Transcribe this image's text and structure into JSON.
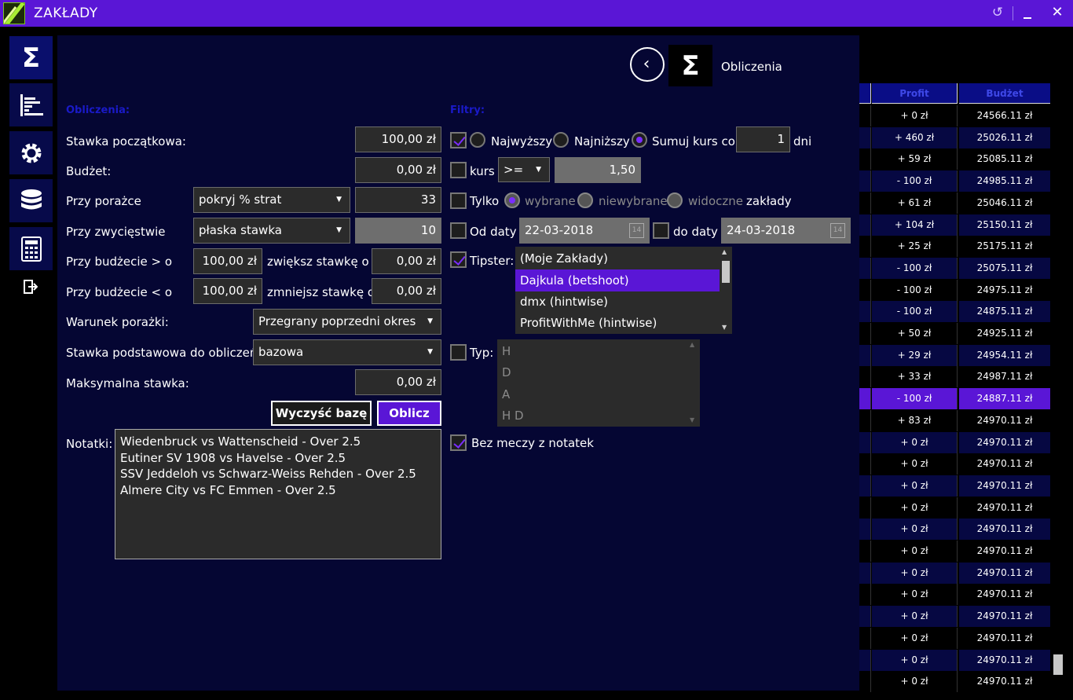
{
  "window": {
    "title": "ZAKŁADY"
  },
  "nav": {
    "sum_symbol": "Σ"
  },
  "header": {
    "title": "Obliczenia",
    "sum_symbol": "Σ",
    "back_glyph": "‹"
  },
  "calc": {
    "section_title": "Obliczenia:",
    "starting_stake_label": "Stawka początkowa:",
    "starting_stake_value": "100,00 zł",
    "budget_label": "Budżet:",
    "budget_value": "0,00 zł",
    "on_loss_label": "Przy porażce",
    "on_loss_mode": "pokryj % strat",
    "on_loss_value": "33",
    "on_win_label": "Przy zwycięstwie",
    "on_win_mode": "płaska stawka",
    "on_win_value": "10",
    "budget_gt_label": "Przy budżecie > o",
    "budget_gt_value": "100,00 zł",
    "increase_label": "zwiększ stawkę o",
    "increase_value": "0,00 zł",
    "budget_lt_label": "Przy budżecie < o",
    "budget_lt_value": "100,00 zł",
    "decrease_label": "zmniejsz stawkę o",
    "decrease_value": "0,00 zł",
    "loss_condition_label": "Warunek porażki:",
    "loss_condition_value": "Przegrany poprzedni okres",
    "base_stake_label": "Stawka podstawowa do obliczeń:",
    "base_stake_value": "bazowa",
    "max_stake_label": "Maksymalna stawka:",
    "max_stake_value": "0,00 zł",
    "clear_button": "Wyczyść bazę",
    "calc_button": "Oblicz",
    "notes_label": "Notatki:",
    "notes": [
      "Wiedenbruck vs Wattenscheid - Over 2.5",
      "Eutiner SV 1908 vs Havelse - Over 2.5",
      "SSV Jeddeloh vs Schwarz-Weiss Rehden - Over 2.5",
      "Almere City vs FC Emmen - Over 2.5"
    ]
  },
  "filters": {
    "section_title": "Filtry:",
    "radio_highest": "Najwyższy",
    "radio_lowest": "Najniższy",
    "radio_sum": "Sumuj",
    "odds_every_label": "kurs co",
    "odds_every_value": "1",
    "days_label": "dni",
    "odds_label": "kurs",
    "odds_operator": ">=",
    "odds_value": "1,50",
    "only_label": "Tylko",
    "radio_selected": "wybrane",
    "radio_unselected": "niewybrane",
    "radio_visible": "widoczne",
    "bets_label": "zakłady",
    "from_date_label": "Od daty",
    "from_date": "22-03-2018",
    "to_date_label": "do daty",
    "to_date": "24-03-2018",
    "calendar_day": "14",
    "tipster_label": "Tipster:",
    "tipsters": [
      "(Moje Zakłady)",
      "Dajkula (betshoot)",
      "dmx (hintwise)",
      "ProfitWithMe (hintwise)"
    ],
    "type_label": "Typ:",
    "types": [
      "H",
      "D",
      "A",
      "H D"
    ],
    "no_notes_label": "Bez meczy z notatek"
  },
  "table": {
    "headers": {
      "profit": "Profit",
      "budget": "Budżet"
    },
    "rows": [
      {
        "profit": "+ 0 zł",
        "budget": "24566.11 zł"
      },
      {
        "profit": "+ 460 zł",
        "budget": "25026.11 zł"
      },
      {
        "profit": "+ 59 zł",
        "budget": "25085.11 zł"
      },
      {
        "profit": "- 100 zł",
        "budget": "24985.11 zł"
      },
      {
        "profit": "+ 61 zł",
        "budget": "25046.11 zł"
      },
      {
        "profit": "+ 104 zł",
        "budget": "25150.11 zł"
      },
      {
        "profit": "+ 25 zł",
        "budget": "25175.11 zł"
      },
      {
        "profit": "- 100 zł",
        "budget": "25075.11 zł"
      },
      {
        "profit": "- 100 zł",
        "budget": "24975.11 zł"
      },
      {
        "profit": "- 100 zł",
        "budget": "24875.11 zł"
      },
      {
        "profit": "+ 50 zł",
        "budget": "24925.11 zł"
      },
      {
        "profit": "+ 29 zł",
        "budget": "24954.11 zł"
      },
      {
        "profit": "+ 33 zł",
        "budget": "24987.11 zł"
      },
      {
        "profit": "- 100 zł",
        "budget": "24887.11 zł"
      },
      {
        "profit": "+ 83 zł",
        "budget": "24970.11 zł"
      },
      {
        "profit": "+ 0 zł",
        "budget": "24970.11 zł"
      },
      {
        "profit": "+ 0 zł",
        "budget": "24970.11 zł"
      },
      {
        "profit": "+ 0 zł",
        "budget": "24970.11 zł"
      },
      {
        "profit": "+ 0 zł",
        "budget": "24970.11 zł"
      },
      {
        "profit": "+ 0 zł",
        "budget": "24970.11 zł"
      },
      {
        "profit": "+ 0 zł",
        "budget": "24970.11 zł"
      },
      {
        "profit": "+ 0 zł",
        "budget": "24970.11 zł"
      },
      {
        "profit": "+ 0 zł",
        "budget": "24970.11 zł"
      },
      {
        "profit": "+ 0 zł",
        "budget": "24970.11 zł"
      },
      {
        "profit": "+ 0 zł",
        "budget": "24970.11 zł"
      },
      {
        "profit": "+ 0 zł",
        "budget": "24970.11 zł"
      },
      {
        "profit": "+ 0 zł",
        "budget": "24970.11 zł"
      }
    ]
  }
}
